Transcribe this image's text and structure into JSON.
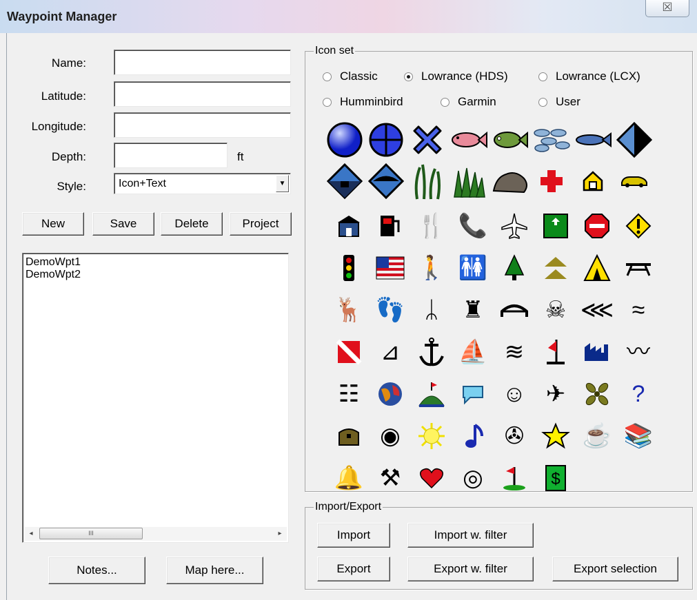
{
  "window": {
    "title": "Waypoint Manager",
    "close_glyph": "☒"
  },
  "form": {
    "name_label": "Name:",
    "latitude_label": "Latitude:",
    "longitude_label": "Longitude:",
    "depth_label": "Depth:",
    "depth_unit": "ft",
    "style_label": "Style:",
    "name_value": "",
    "latitude_value": "",
    "longitude_value": "",
    "depth_value": "",
    "style_value": "Icon+Text"
  },
  "buttons": {
    "new": "New",
    "save": "Save",
    "delete": "Delete",
    "project": "Project",
    "notes": "Notes...",
    "map_here": "Map here..."
  },
  "waypoints": [
    "DemoWpt1",
    "DemoWpt2"
  ],
  "scrollbar": {
    "thumb_glyph": "III",
    "left_arrow": "◂",
    "right_arrow": "▸"
  },
  "icon_set": {
    "title": "Icon set",
    "options": [
      "Classic",
      "Lowrance (HDS)",
      "Lowrance (LCX)",
      "Humminbird",
      "Garmin",
      "User"
    ],
    "selected": "Lowrance (HDS)"
  },
  "icons": [
    "sphere-icon",
    "crosshair-diamond-icon",
    "x-mark-icon",
    "red-fish-icon",
    "green-fish-icon",
    "fish-school-icon",
    "blue-fish-icon",
    "black-diamond-icon",
    "diamond-down-icon",
    "diamond-up-icon",
    "weeds-icon",
    "grass-icon",
    "rock-icon",
    "red-cross-icon",
    "house-icon",
    "car-icon",
    "building-icon",
    "gas-pump-icon",
    "restaurant-icon",
    "phone-icon",
    "airplane-icon",
    "exit-sign-icon",
    "stop-sign-icon",
    "warning-icon",
    "traffic-light-icon",
    "us-flag-icon",
    "person-icon",
    "restroom-icon",
    "tree-icon",
    "tent-ridge-icon",
    "tent-icon",
    "picnic-table-icon",
    "deer-icon",
    "tracks-icon",
    "bird-tracks-icon",
    "tower-icon",
    "bridge-icon",
    "skull-icon",
    "fish-outline-icon",
    "two-fish-icon",
    "dive-flag-icon",
    "boat-ramp-icon",
    "anchor-icon",
    "boat-icon",
    "launch-icon",
    "marker-flag-icon",
    "factory-icon",
    "waves-icon",
    "dock-icon",
    "globe-icon",
    "island-icon",
    "speech-bubble-icon",
    "ghost-icon",
    "plane-wreck-icon",
    "propeller-icon",
    "question-icon",
    "treasure-chest-icon",
    "webcam-icon",
    "sun-icon",
    "music-note-icon",
    "movie-camera-icon",
    "star-icon",
    "coffee-mug-icon",
    "books-icon",
    "bell-icon",
    "tools-icon",
    "heart-icon",
    "drum-icon",
    "golf-flag-icon",
    "dollar-icon"
  ],
  "import_export": {
    "title": "Import/Export",
    "import": "Import",
    "import_filter": "Import w. filter",
    "export": "Export",
    "export_filter": "Export w. filter",
    "export_selection": "Export selection"
  }
}
